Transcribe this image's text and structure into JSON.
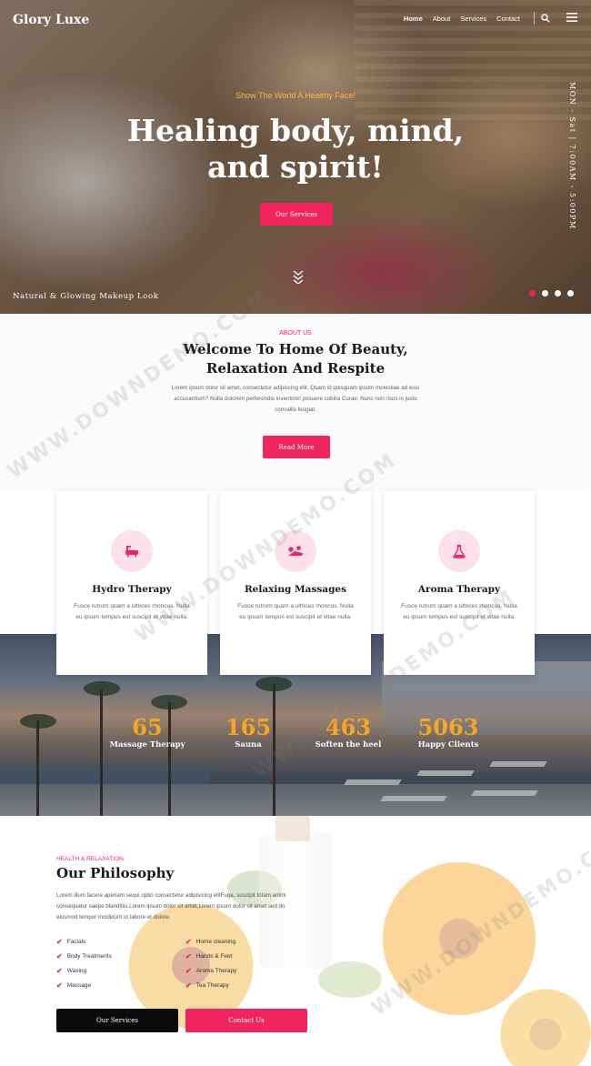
{
  "header": {
    "brand": "Glory Luxe",
    "nav": [
      {
        "label": "Home",
        "active": true
      },
      {
        "label": "About"
      },
      {
        "label": "Services"
      },
      {
        "label": "Contact"
      }
    ],
    "icons": [
      "search-icon",
      "menu-icon"
    ]
  },
  "hero": {
    "tagline": "Show The World A Healthy Face!",
    "title_line1": "Healing body, mind,",
    "title_line2": "and spirit!",
    "button": "Our Services",
    "caption": "Natural & Glowing Makeup Look",
    "hours": "MON - Sat | 7:00AM - 5:00PM",
    "slides": 4,
    "active_slide": 1
  },
  "about": {
    "label": "ABOUT US",
    "title_line1": "Welcome To Home Of Beauty,",
    "title_line2": "Relaxation And Respite",
    "text": "Lorem ipsum dolor sit amet, consectetur adipiscing elit. Quam id quisquam ipsum molestiae ad eius accusantium? Nulla dolorem perferendis inventore! posuere cubilia Curae; Nunc non risus in justo convallis feugiat.",
    "button": "Read More"
  },
  "services": [
    {
      "title": "Hydro Therapy",
      "text": "Fusce rutrum quam a ultrices rhoncus. Nulla eu ipsum tempus est suscipit et vitae nulla.",
      "icon": "bathtub-icon"
    },
    {
      "title": "Relaxing Massages",
      "text": "Fusce rutrum quam a ultrices rhoncus. Nulla eu ipsum tempus est suscipit et vitae nulla.",
      "icon": "massage-icon"
    },
    {
      "title": "Aroma Therapy",
      "text": "Fusce rutrum quam a ultrices rhoncus. Nulla eu ipsum tempus est suscipit et vitae nulla.",
      "icon": "flask-icon"
    }
  ],
  "stats": [
    {
      "value": "65",
      "label": "Massage Therapy"
    },
    {
      "value": "165",
      "label": "Sauna"
    },
    {
      "value": "463",
      "label": "Soften the heel"
    },
    {
      "value": "5063",
      "label": "Happy Clients"
    }
  ],
  "philosophy": {
    "label": "HEALTH & RELAXATION",
    "title": "Our Philosophy",
    "text": "Lorem illum facere aperiam sequi optio consectetur adipisicing elitFuga, suscipit totam animi consequatur saepe blanditiis.Lorem ipsum dolor sit amet,Lorem ipsum dolor sit amet sed do eiusmod tempor incididunt ut labore et dolore.",
    "list_left": [
      "Facials",
      "Body Treatments",
      "Waxing",
      "Massage"
    ],
    "list_right": [
      "Home cleaning",
      "Hands & Feet",
      "Aroma Therapy",
      "Tea Therapy"
    ],
    "button_primary": "Our Services",
    "button_secondary": "Contact Us"
  },
  "watermark": "WWW.DOWNDEMO.COM",
  "colors": {
    "accent": "#f0245f",
    "stat": "#f5a623",
    "hero_tag": "#ffb347",
    "dark": "#0b0b0b"
  }
}
